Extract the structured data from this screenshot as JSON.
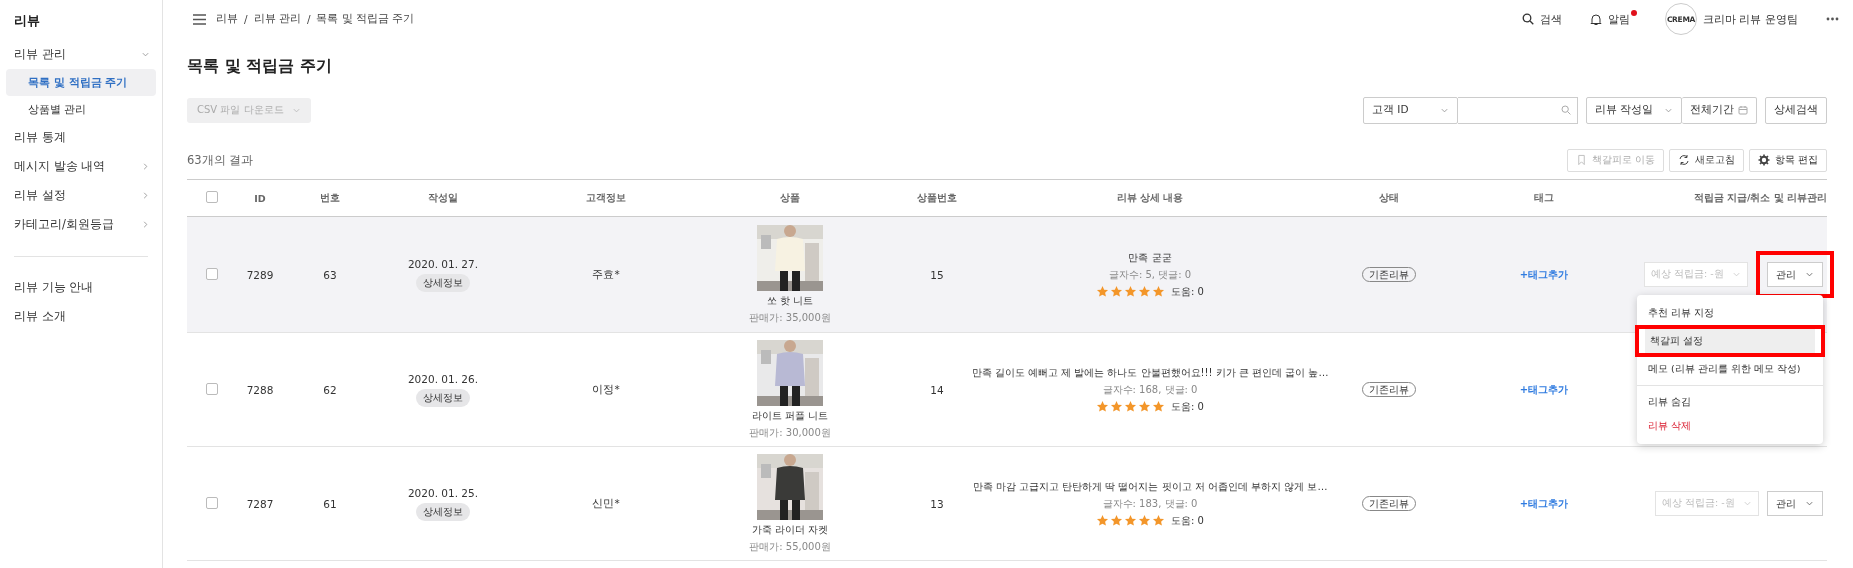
{
  "sidebar": {
    "title": "리뷰",
    "items": [
      {
        "kind": "group",
        "label": "리뷰 관리",
        "expanded": true,
        "selected": false,
        "children": [
          {
            "label": "목록 및 적립금 주기",
            "selected": true
          },
          {
            "label": "상품별 관리",
            "selected": false
          }
        ]
      },
      {
        "kind": "link",
        "label": "리뷰 통계",
        "selected": false
      },
      {
        "kind": "group",
        "label": "메시지 발송 내역",
        "expanded": false,
        "selected": false
      },
      {
        "kind": "group",
        "label": "리뷰 설정",
        "expanded": false,
        "selected": false
      },
      {
        "kind": "group",
        "label": "카테고리/회원등급",
        "expanded": false,
        "selected": false
      }
    ],
    "footer_links": [
      "리뷰 기능 안내",
      "리뷰 소개"
    ]
  },
  "header": {
    "breadcrumb": [
      "리뷰",
      "리뷰 관리",
      "목록 및 적립금 주기"
    ],
    "breadcrumb_separator": "/",
    "search": "검색",
    "alerts": {
      "label": "알림",
      "unread": true
    },
    "avatar_text": "CREMA",
    "account": "크리마 리뷰 운영팀"
  },
  "page_title": "목록 및 적립금 주기",
  "csv_button": {
    "label": "CSV 파일 다운로드",
    "disabled": true
  },
  "filters": {
    "key_select": "고객 ID",
    "date_select": "리뷰 작성일",
    "period": "전체기간",
    "advanced": "상세검색"
  },
  "result_count": "63개의 결과",
  "tools": [
    {
      "label": "책갈피로 이동",
      "kind": "bookmark",
      "disabled": true
    },
    {
      "label": "새로고침",
      "kind": "refresh",
      "disabled": false
    },
    {
      "label": "항목 편집",
      "kind": "gear",
      "disabled": false
    }
  ],
  "table": {
    "select_all": {
      "checked": false
    },
    "columns": [
      "ID",
      "번호",
      "작성일",
      "고객정보",
      "상품",
      "상품번호",
      "리뷰 상세 내용",
      "상태",
      "태그",
      "적립금 지급/취소 및 리뷰관리"
    ],
    "rows": [
      {
        "checked": false,
        "hover": true,
        "id": "7289",
        "number": "63",
        "date": "2020. 01. 27.",
        "detail": "상세정보",
        "customer": "주효*",
        "product": {
          "name": "쏘 핫 니트",
          "price": "판매가: 35,000원",
          "kind": "picture"
        },
        "product_no": "15",
        "review": {
          "text": "만족 굳굳",
          "meta": "글자수: 5, 댓글: 0",
          "stars": 5,
          "helpful": "도움: 0"
        },
        "status": "기존리뷰",
        "tag": "+태그추가",
        "actions": {
          "points": "예상 적립금: -원",
          "manage": "관리",
          "annotated": true
        }
      },
      {
        "checked": false,
        "hover": false,
        "id": "7288",
        "number": "62",
        "date": "2020. 01. 26.",
        "detail": "상세정보",
        "customer": "이정*",
        "product": {
          "name": "라이트 퍼플 니트",
          "price": "판매가: 30,000원",
          "kind": "picture"
        },
        "product_no": "14",
        "review": {
          "text": "만족 길이도 예뻐고 제 발에는 하나도 안불편했어요!!! 키가 큰 편인데 굽이 높…",
          "meta": "글자수: 168, 댓글: 0",
          "stars": 5,
          "helpful": "도움: 0"
        },
        "status": "기존리뷰",
        "tag": "+태그추가"
      },
      {
        "checked": false,
        "hover": false,
        "id": "7287",
        "number": "61",
        "date": "2020. 01. 25.",
        "detail": "상세정보",
        "customer": "신민*",
        "product": {
          "name": "가죽 라이더 자켓",
          "price": "판매가: 55,000원",
          "kind": "picture"
        },
        "product_no": "13",
        "review": {
          "text": "만족 마감 고급지고 탄탄하게 딱 떨어지는 핏이고 저 어좁인데 부하지 않게 보…",
          "meta": "글자수: 183, 댓글: 0",
          "stars": 5,
          "helpful": "도움: 0"
        },
        "status": "기존리뷰",
        "tag": "+태그추가",
        "actions": {
          "points": "예상 적립금: -원",
          "manage": "관리",
          "annotated": false
        }
      }
    ]
  },
  "manage_menu": {
    "items": [
      {
        "label": "추천 리뷰 지정",
        "kind": "normal",
        "selected": false,
        "annotated": false
      },
      {
        "label": "책갈피 설정",
        "kind": "normal",
        "selected": true,
        "annotated": true
      },
      {
        "label": "메모 (리뷰 관리를 위한 메모 작성)",
        "kind": "normal",
        "selected": false,
        "annotated": false
      },
      {
        "label": "리뷰 숨김",
        "kind": "normal",
        "selected": false,
        "annotated": false,
        "divider_before": true
      },
      {
        "label": "리뷰 삭제",
        "kind": "danger",
        "selected": false,
        "annotated": false
      }
    ]
  }
}
